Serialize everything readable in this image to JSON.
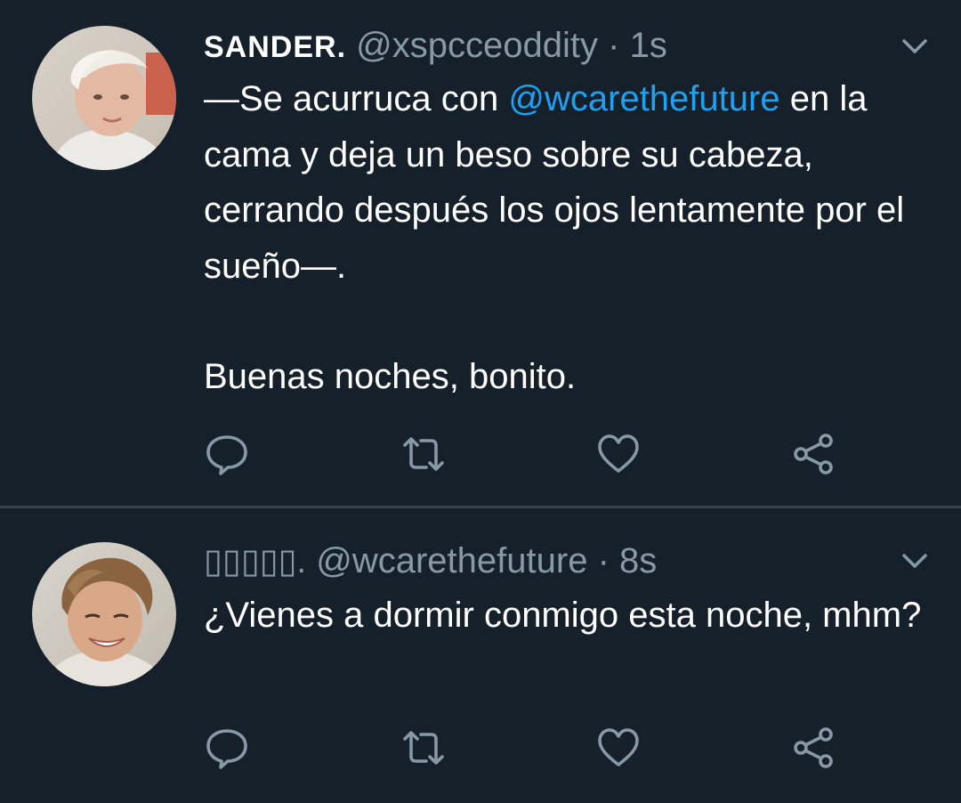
{
  "colors": {
    "background": "#15202b",
    "divider": "#38444d",
    "text_primary": "#ffffff",
    "text_secondary": "#8899a6",
    "mention": "#1da1f2"
  },
  "tweets": [
    {
      "display_name": "SANDER.",
      "handle": "@xspcceoddity",
      "separator": "·",
      "time": "1s",
      "text_before_mention": "—Se acurruca con ",
      "mention": "@wcarethefuture",
      "text_after_mention": " en la cama y deja un beso sobre su cabeza, cerrando después los ojos lentamente por el sueño—.",
      "text_paragraph_2": "Buenas noches, bonito.",
      "icons": [
        "chevron-down-icon",
        "reply-icon",
        "retweet-icon",
        "like-icon",
        "share-icon"
      ]
    },
    {
      "display_name": "▯▯▯▯▯.",
      "handle": "@wcarethefuture",
      "separator": "·",
      "time": "8s",
      "text": "¿Vienes a dormir conmigo esta noche, mhm?",
      "icons": [
        "chevron-down-icon",
        "reply-icon",
        "retweet-icon",
        "like-icon",
        "share-icon"
      ]
    }
  ]
}
